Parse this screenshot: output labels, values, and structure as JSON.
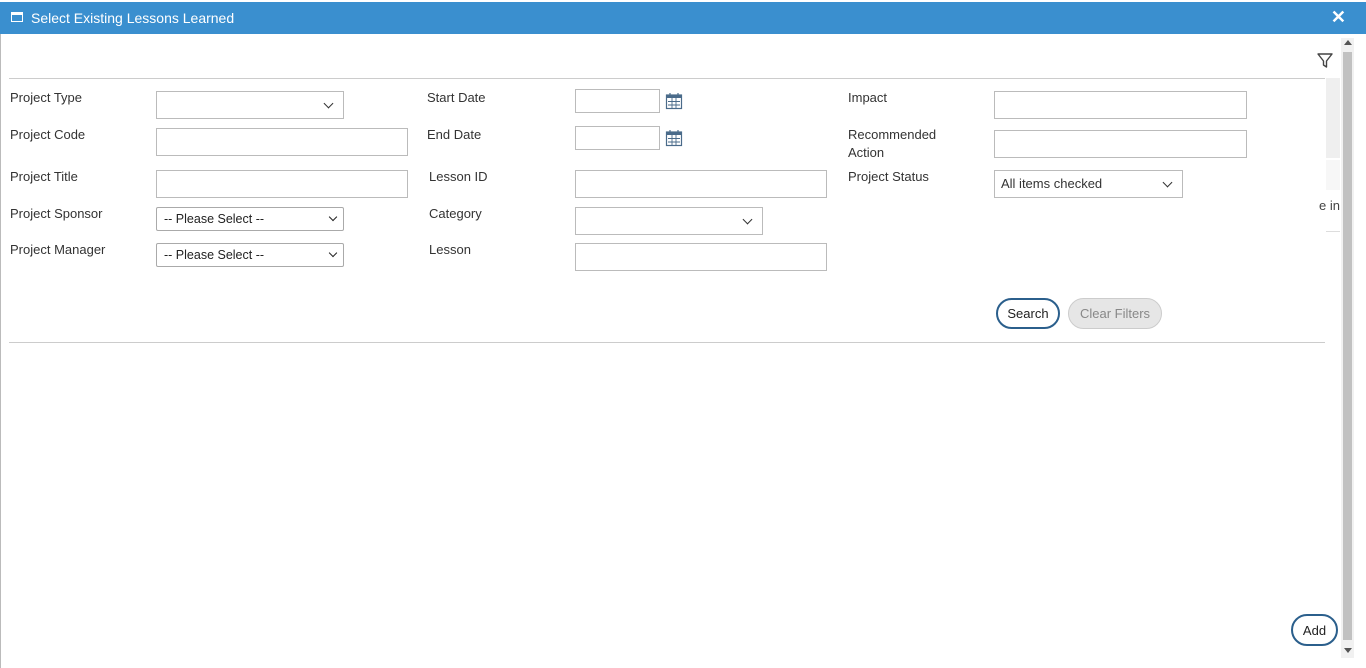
{
  "dialog": {
    "title": "Select Existing Lessons Learned",
    "close_glyph": "✕"
  },
  "filters": {
    "project_type_label": "Project Type",
    "project_code_label": "Project Code",
    "project_title_label": "Project Title",
    "project_sponsor_label": "Project Sponsor",
    "project_sponsor_value": "-- Please Select --",
    "project_manager_label": "Project Manager",
    "project_manager_value": "-- Please Select --",
    "start_date_label": "Start Date",
    "end_date_label": "End Date",
    "lesson_id_label": "Lesson ID",
    "category_label": "Category",
    "lesson_label": "Lesson",
    "impact_label": "Impact",
    "recommended_action_label": "Recommended Action",
    "project_status_label": "Project Status",
    "project_status_value": "All items checked"
  },
  "actions": {
    "search_label": "Search",
    "clear_filters_label": "Clear Filters",
    "add_label": "Add"
  },
  "side_fragment": "e in",
  "icons": {
    "window": "window-icon",
    "close": "close-icon",
    "filter": "filter-icon",
    "calendar": "calendar-icon",
    "chevron": "chevron-down-icon"
  },
  "colors": {
    "titlebar": "#3a8fcf",
    "button_border": "#2b5f8c"
  }
}
